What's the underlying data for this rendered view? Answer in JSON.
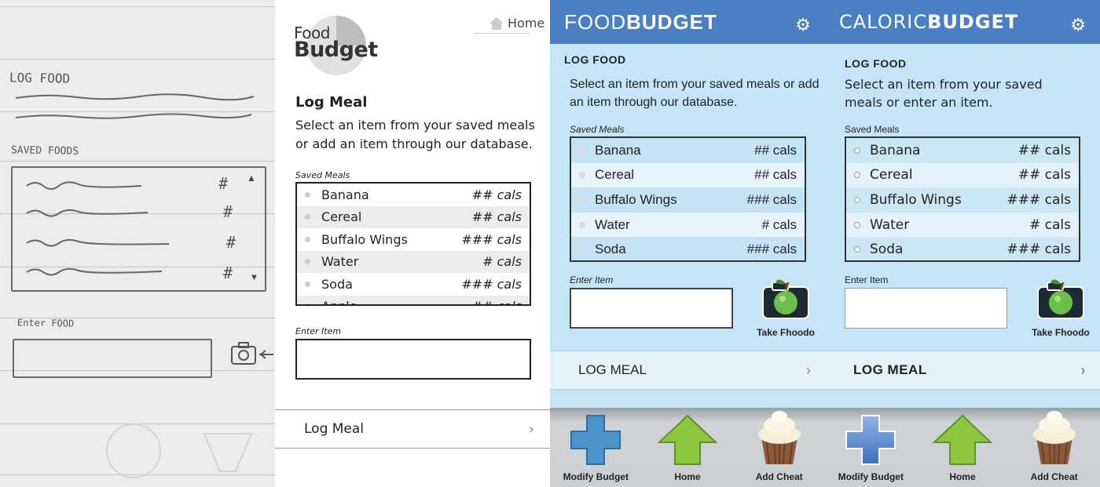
{
  "sketch": {
    "log_food": "LOG FOOD",
    "saved_foods": "SAVED FOODS",
    "enter_food": "Enter FOOD",
    "hash": "#"
  },
  "wireframe": {
    "logo_line1": "Food",
    "logo_line2": "Budget",
    "home_link": "Home",
    "title": "Log Meal",
    "description": "Select an item from your saved meals or add an item through our database.",
    "saved_label": "Saved Meals",
    "items": [
      {
        "name": "Banana",
        "cals": "## cals"
      },
      {
        "name": "Cereal",
        "cals": "## cals"
      },
      {
        "name": "Buffalo Wings",
        "cals": "### cals"
      },
      {
        "name": "Water",
        "cals": "# cals"
      },
      {
        "name": "Soda",
        "cals": "### cals"
      },
      {
        "name": "Apple",
        "cals": "## cals"
      }
    ],
    "enter_label": "Enter Item",
    "log_meal": "Log Meal",
    "chevron": "›"
  },
  "mock1": {
    "title_light": "FOOD",
    "title_bold": "BUDGET",
    "section": "LOG FOOD",
    "description": "Select an item from your saved meals or add an item through our database.",
    "saved_label": "Saved Meals",
    "items": [
      {
        "name": "Banana",
        "cals": "## cals"
      },
      {
        "name": "Cereal",
        "cals": "## cals"
      },
      {
        "name": "Buffalo Wings",
        "cals": "### cals"
      },
      {
        "name": "Water",
        "cals": "# cals"
      },
      {
        "name": "Soda",
        "cals": "### cals"
      }
    ],
    "enter_label": "Enter Item",
    "camera_label": "Take Fhoodo",
    "log_meal": "LOG MEAL",
    "chevron": "›",
    "nav": [
      "Modify Budget",
      "Home",
      "Add Cheat"
    ]
  },
  "mock2": {
    "title_light": "CALORIC",
    "title_bold": "BUDGET",
    "section": "LOG FOOD",
    "description": "Select an item from your saved meals or enter an item.",
    "saved_label": "Saved Meals",
    "items": [
      {
        "name": "Banana",
        "cals": "## cals"
      },
      {
        "name": "Cereal",
        "cals": "## cals"
      },
      {
        "name": "Buffalo Wings",
        "cals": "### cals"
      },
      {
        "name": "Water",
        "cals": "# cals"
      },
      {
        "name": "Soda",
        "cals": "### cals"
      }
    ],
    "enter_label": "Enter Item",
    "camera_label": "Take Fhoodo",
    "log_meal": "LOG MEAL",
    "chevron": "›",
    "nav": [
      "Modify Budget",
      "Home",
      "Add Cheat"
    ]
  },
  "colors": {
    "header_blue": "#4a7fc3",
    "panel_blue": "#c5e5f6",
    "plus_blue": "#4b93c9",
    "home_green": "#8dc63f"
  },
  "icons": [
    "gear-icon",
    "camera-icon",
    "plus-icon",
    "home-arrow-icon",
    "cupcake-icon",
    "chevron-right-icon"
  ]
}
